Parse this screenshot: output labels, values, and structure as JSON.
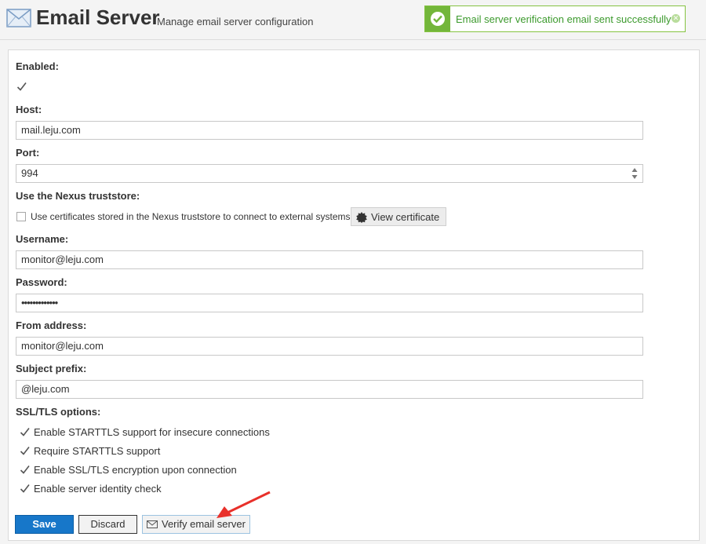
{
  "header": {
    "title": "Email Server",
    "subtitle": "Manage email server configuration",
    "icon": "envelope-icon"
  },
  "toast": {
    "message": "Email server verification email sent successfully",
    "close_glyph": "✕",
    "status_color": "#73b63a"
  },
  "form": {
    "enabled": {
      "label": "Enabled:",
      "checked": true
    },
    "host": {
      "label": "Host:",
      "value": "mail.leju.com"
    },
    "port": {
      "label": "Port:",
      "value": "994"
    },
    "truststore": {
      "label": "Use the Nexus truststore:",
      "checkbox_text": "Use certificates stored in the Nexus truststore to connect to external systems",
      "checked": false,
      "view_cert_label": "View certificate"
    },
    "username": {
      "label": "Username:",
      "value": "monitor@leju.com"
    },
    "password": {
      "label": "Password:",
      "value": "•••••••••••••"
    },
    "from_address": {
      "label": "From address:",
      "value": "monitor@leju.com"
    },
    "subject_prefix": {
      "label": "Subject prefix:",
      "value": "@leju.com"
    },
    "ssl": {
      "label": "SSL/TLS options:",
      "options": [
        {
          "text": "Enable STARTTLS support for insecure connections",
          "checked": true
        },
        {
          "text": "Require STARTTLS support",
          "checked": true
        },
        {
          "text": "Enable SSL/TLS encryption upon connection",
          "checked": true
        },
        {
          "text": "Enable server identity check",
          "checked": true
        }
      ]
    }
  },
  "buttons": {
    "save": "Save",
    "discard": "Discard",
    "verify": "Verify email server"
  },
  "colors": {
    "primary": "#1777c9",
    "success_text": "#3c9a2d",
    "annotation_arrow": "#e8302a"
  }
}
